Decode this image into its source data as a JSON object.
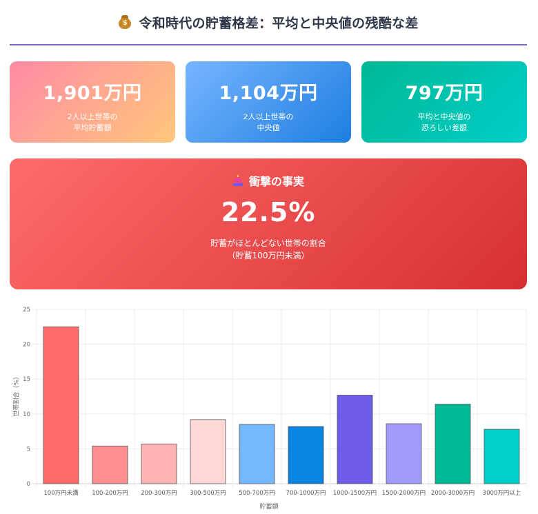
{
  "header": {
    "title": "令和時代の貯蓄格差：平均と中央値の残酷な差",
    "icon": "money-bag-icon"
  },
  "cards": [
    {
      "value": "1,901万円",
      "label": "2人以上世帯の\n平均貯蓄額"
    },
    {
      "value": "1,104万円",
      "label": "2人以上世帯の\n中央値"
    },
    {
      "value": "797万円",
      "label": "平均と中央値の\n恐ろしい差額"
    }
  ],
  "highlight": {
    "icon": "siren-icon",
    "title": "衝撃の事実",
    "value": "22.5%",
    "description": "貯蓄がほとんどない世帯の割合\n（貯蓄100万円未満）"
  },
  "chart_data": {
    "type": "bar",
    "categories": [
      "100万円未満",
      "100-200万円",
      "200-300万円",
      "300-500万円",
      "500-700万円",
      "700-1000万円",
      "1000-1500万円",
      "1500-2000万円",
      "2000-3000万円",
      "3000万円以上"
    ],
    "values": [
      22.5,
      5.4,
      5.7,
      9.2,
      8.5,
      8.2,
      12.7,
      8.6,
      11.4,
      7.8
    ],
    "colors": [
      "#ff6b6b",
      "#ff8e8e",
      "#ffb3b3",
      "#ffd7d7",
      "#74b9ff",
      "#0984e3",
      "#6c5ce7",
      "#a29bfe",
      "#00b894",
      "#00cec9"
    ],
    "xlabel": "貯蓄額",
    "ylabel": "世帯割合（%）",
    "ylim": [
      0,
      25
    ],
    "yticks": [
      0,
      5,
      10,
      15,
      20,
      25
    ],
    "grid": true
  }
}
